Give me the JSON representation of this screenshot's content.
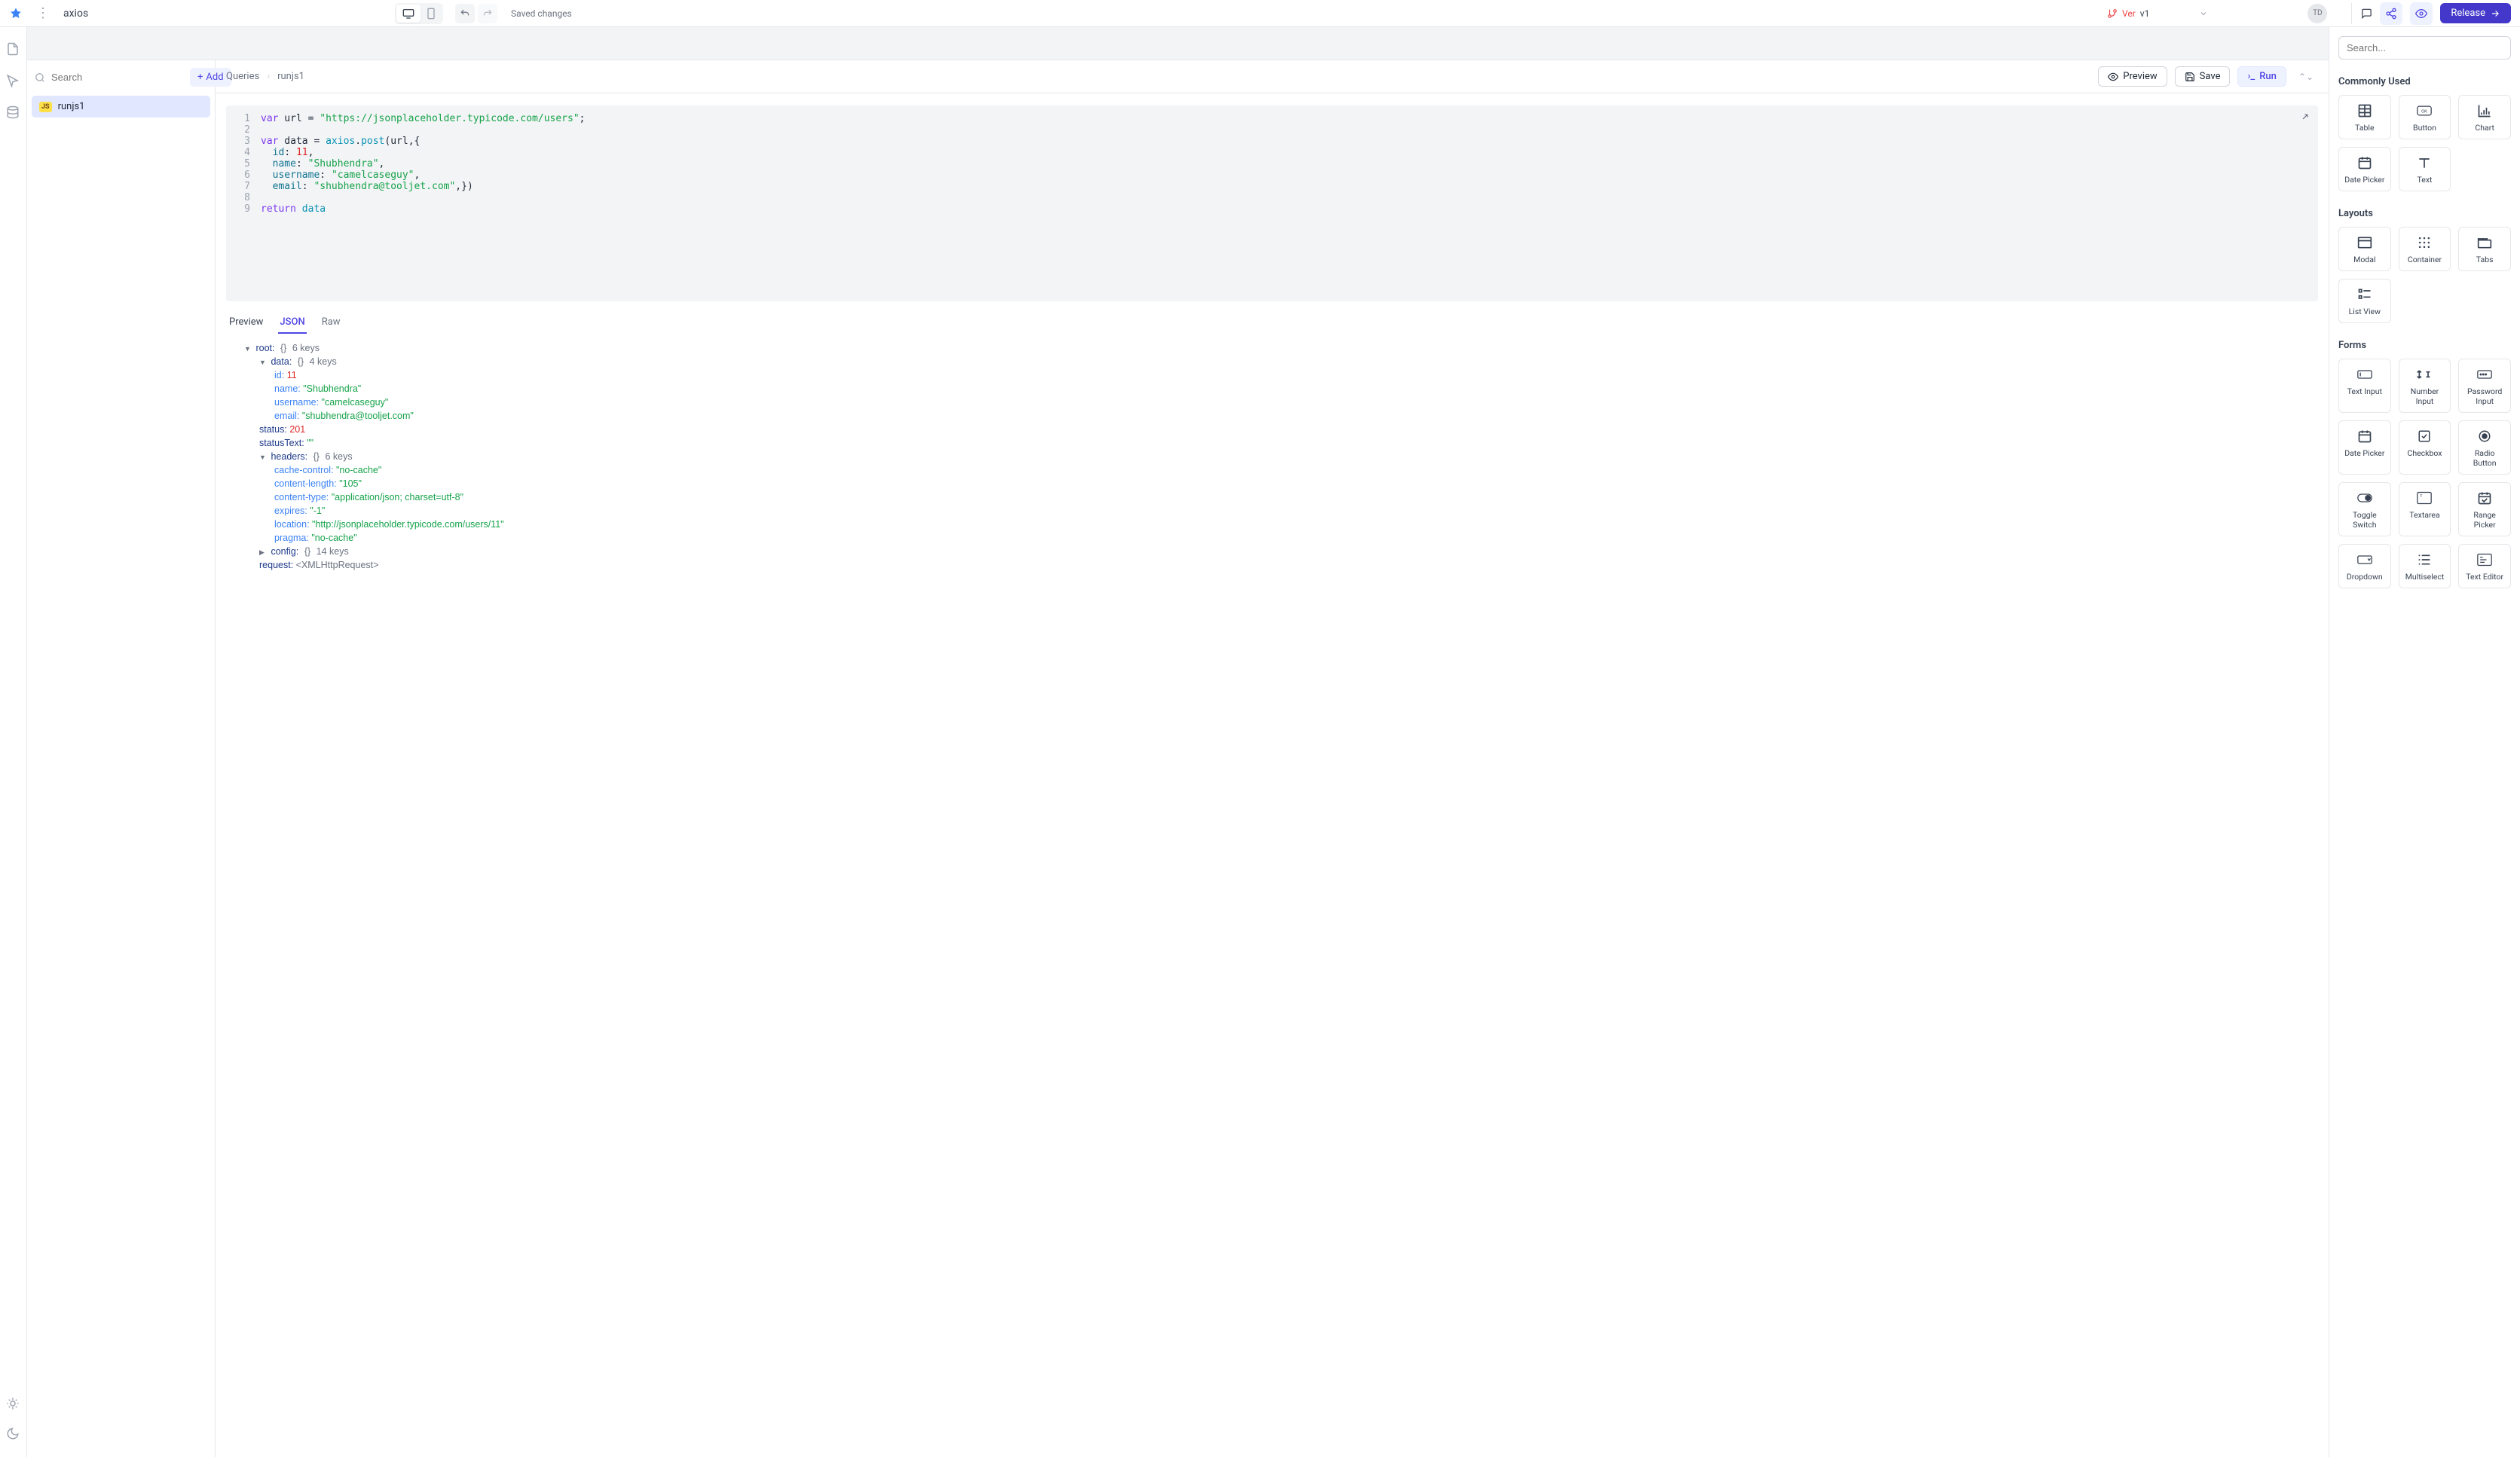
{
  "topbar": {
    "app_title": "axios",
    "saved_status": "Saved changes",
    "version_prefix": "Ver",
    "version_value": "v1",
    "avatar_initials": "TD",
    "release_label": "Release"
  },
  "query_sidebar": {
    "search_placeholder": "Search",
    "add_label": "Add",
    "items": [
      {
        "badge": "JS",
        "name": "runjs1"
      }
    ]
  },
  "query_header": {
    "breadcrumb": [
      "Queries",
      "runjs1"
    ],
    "preview_label": "Preview",
    "save_label": "Save",
    "run_label": "Run"
  },
  "code": {
    "lines": [
      [
        {
          "t": "kw",
          "v": "var"
        },
        {
          "t": "plain",
          "v": " url = "
        },
        {
          "t": "str",
          "v": "\"https://jsonplaceholder.typicode.com/users\""
        },
        {
          "t": "plain",
          "v": ";"
        }
      ],
      [],
      [
        {
          "t": "kw",
          "v": "var"
        },
        {
          "t": "plain",
          "v": " data = "
        },
        {
          "t": "ident",
          "v": "axios"
        },
        {
          "t": "plain",
          "v": "."
        },
        {
          "t": "fn",
          "v": "post"
        },
        {
          "t": "plain",
          "v": "(url,{"
        }
      ],
      [
        {
          "t": "plain",
          "v": "  "
        },
        {
          "t": "prop",
          "v": "id"
        },
        {
          "t": "plain",
          "v": ": "
        },
        {
          "t": "num",
          "v": "11"
        },
        {
          "t": "plain",
          "v": ","
        }
      ],
      [
        {
          "t": "plain",
          "v": "  "
        },
        {
          "t": "prop",
          "v": "name"
        },
        {
          "t": "plain",
          "v": ": "
        },
        {
          "t": "str",
          "v": "\"Shubhendra\""
        },
        {
          "t": "plain",
          "v": ","
        }
      ],
      [
        {
          "t": "plain",
          "v": "  "
        },
        {
          "t": "prop",
          "v": "username"
        },
        {
          "t": "plain",
          "v": ": "
        },
        {
          "t": "str",
          "v": "\"camelcaseguy\""
        },
        {
          "t": "plain",
          "v": ","
        }
      ],
      [
        {
          "t": "plain",
          "v": "  "
        },
        {
          "t": "prop",
          "v": "email"
        },
        {
          "t": "plain",
          "v": ": "
        },
        {
          "t": "str",
          "v": "\"shubhendra@tooljet.com\""
        },
        {
          "t": "plain",
          "v": ",})"
        }
      ],
      [],
      [
        {
          "t": "kw",
          "v": "return"
        },
        {
          "t": "plain",
          "v": " "
        },
        {
          "t": "ident",
          "v": "data"
        }
      ]
    ]
  },
  "preview_tabs": {
    "preview": "Preview",
    "json": "JSON",
    "raw": "Raw"
  },
  "json_result": {
    "root_label": "root:",
    "root_meta": "6 keys",
    "data_label": "data:",
    "data_meta": "4 keys",
    "data_fields": {
      "id_k": "id:",
      "id_v": "11",
      "name_k": "name:",
      "name_v": "\"Shubhendra\"",
      "username_k": "username:",
      "username_v": "\"camelcaseguy\"",
      "email_k": "email:",
      "email_v": "\"shubhendra@tooljet.com\""
    },
    "status_k": "status:",
    "status_v": "201",
    "statusText_k": "statusText:",
    "statusText_v": "\"\"",
    "headers_label": "headers:",
    "headers_meta": "6 keys",
    "headers_fields": {
      "cache_k": "cache-control:",
      "cache_v": "\"no-cache\"",
      "len_k": "content-length:",
      "len_v": "\"105\"",
      "type_k": "content-type:",
      "type_v": "\"application/json; charset=utf-8\"",
      "exp_k": "expires:",
      "exp_v": "\"-1\"",
      "loc_k": "location:",
      "loc_v": "\"http://jsonplaceholder.typicode.com/users/11\"",
      "prag_k": "pragma:",
      "prag_v": "\"no-cache\""
    },
    "config_label": "config:",
    "config_meta": "14 keys",
    "request_k": "request:",
    "request_v": "<XMLHttpRequest>"
  },
  "components": {
    "search_placeholder": "Search...",
    "sections": {
      "commonly_used": "Commonly Used",
      "layouts": "Layouts",
      "forms": "Forms"
    },
    "commonly_used": [
      "Table",
      "Button",
      "Chart",
      "Date Picker",
      "Text"
    ],
    "layouts": [
      "Modal",
      "Container",
      "Tabs",
      "List View"
    ],
    "forms": [
      "Text Input",
      "Number Input",
      "Password Input",
      "Date Picker",
      "Checkbox",
      "Radio Button",
      "Toggle Switch",
      "Textarea",
      "Range Picker",
      "Dropdown",
      "Multiselect",
      "Text Editor"
    ]
  }
}
